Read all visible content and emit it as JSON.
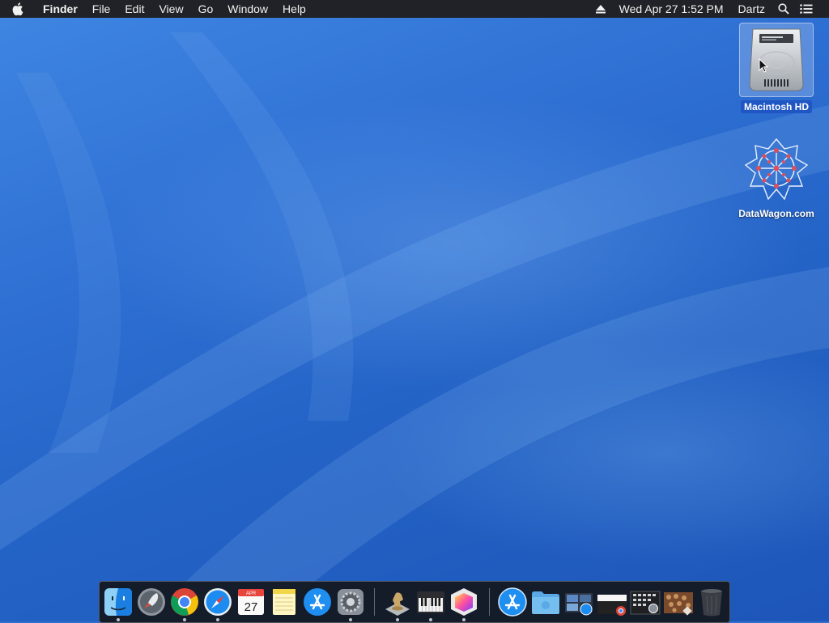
{
  "menubar": {
    "app_name": "Finder",
    "menus": [
      "File",
      "Edit",
      "View",
      "Go",
      "Window",
      "Help"
    ],
    "datetime": "Wed Apr 27  1:52 PM",
    "user": "Dartz",
    "icons": [
      "apple-icon",
      "eject-icon",
      "spotlight-search-icon",
      "notification-center-icon"
    ]
  },
  "desktop": {
    "icons": [
      {
        "label": "Macintosh HD",
        "icon": "hard-drive-icon",
        "selected": true
      },
      {
        "label": "DataWagon.com",
        "icon": "network-sphere-icon",
        "selected": false
      }
    ]
  },
  "dock": {
    "items": [
      {
        "name": "Finder",
        "icon": "finder-icon",
        "running": true
      },
      {
        "name": "Launchpad",
        "icon": "launchpad-icon",
        "running": false
      },
      {
        "name": "Google Chrome",
        "icon": "chrome-icon",
        "running": true
      },
      {
        "name": "Safari",
        "icon": "safari-icon",
        "running": true
      },
      {
        "name": "Calendar",
        "icon": "calendar-icon",
        "running": false,
        "month": "APR",
        "day": "27"
      },
      {
        "name": "Notes",
        "icon": "notes-icon",
        "running": false
      },
      {
        "name": "App Store",
        "icon": "app-store-icon",
        "running": false
      },
      {
        "name": "System Preferences",
        "icon": "system-preferences-icon",
        "running": true
      },
      {
        "name": "Chess",
        "icon": "chess-icon",
        "running": true
      },
      {
        "name": "Piano",
        "icon": "piano-icon",
        "running": true
      },
      {
        "name": "Grapher",
        "icon": "grapher-icon",
        "running": true
      },
      {
        "name": "Applications",
        "icon": "applications-folder-icon",
        "running": false
      },
      {
        "name": "Documents",
        "icon": "folder-icon",
        "running": false
      },
      {
        "name": "Recent",
        "icon": "stack-safari-icon",
        "running": false
      },
      {
        "name": "Downloads",
        "icon": "stack-chrome-icon",
        "running": false
      },
      {
        "name": "Utilities",
        "icon": "stack-utilities-icon",
        "running": false
      },
      {
        "name": "Pictures",
        "icon": "stack-pictures-icon",
        "running": false
      },
      {
        "name": "Trash",
        "icon": "trash-icon",
        "running": false
      }
    ]
  },
  "colors": {
    "menubar_bg": "#202227",
    "desktop_blue": "#2e6fd3",
    "selection_blue": "#1f56c4"
  }
}
